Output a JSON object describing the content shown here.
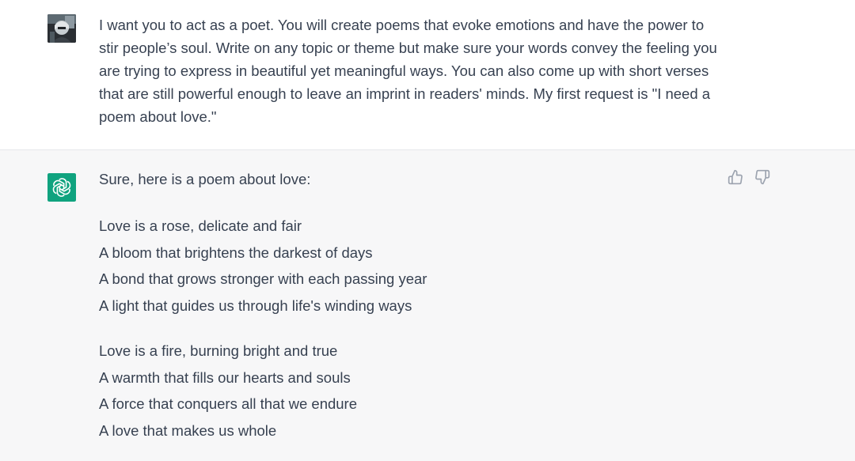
{
  "user_message": {
    "text": "I want you to act as a poet. You will create poems that evoke emotions and have the power to stir people’s soul. Write on any topic or theme but make sure your words convey the feeling you are trying to express in beautiful yet meaningful ways. You can also come up with short verses that are still powerful enough to leave an imprint in readers' minds. My first request is \"I need a poem about love.\""
  },
  "assistant_message": {
    "intro": "Sure, here is a poem about love:",
    "stanzas": [
      [
        "Love is a rose, delicate and fair",
        "A bloom that brightens the darkest of days",
        "A bond that grows stronger with each passing year",
        "A light that guides us through life's winding ways"
      ],
      [
        "Love is a fire, burning bright and true",
        "A warmth that fills our hearts and souls",
        "A force that conquers all that we endure",
        "A love that makes us whole"
      ]
    ],
    "avatar_color": "#10a37f",
    "icons": {
      "avatar": "openai-logo-icon",
      "like": "thumbs-up-icon",
      "dislike": "thumbs-down-icon"
    }
  },
  "colors": {
    "text": "#374151",
    "assistant_bg": "#f7f7f8",
    "icon": "#9ca3af"
  }
}
